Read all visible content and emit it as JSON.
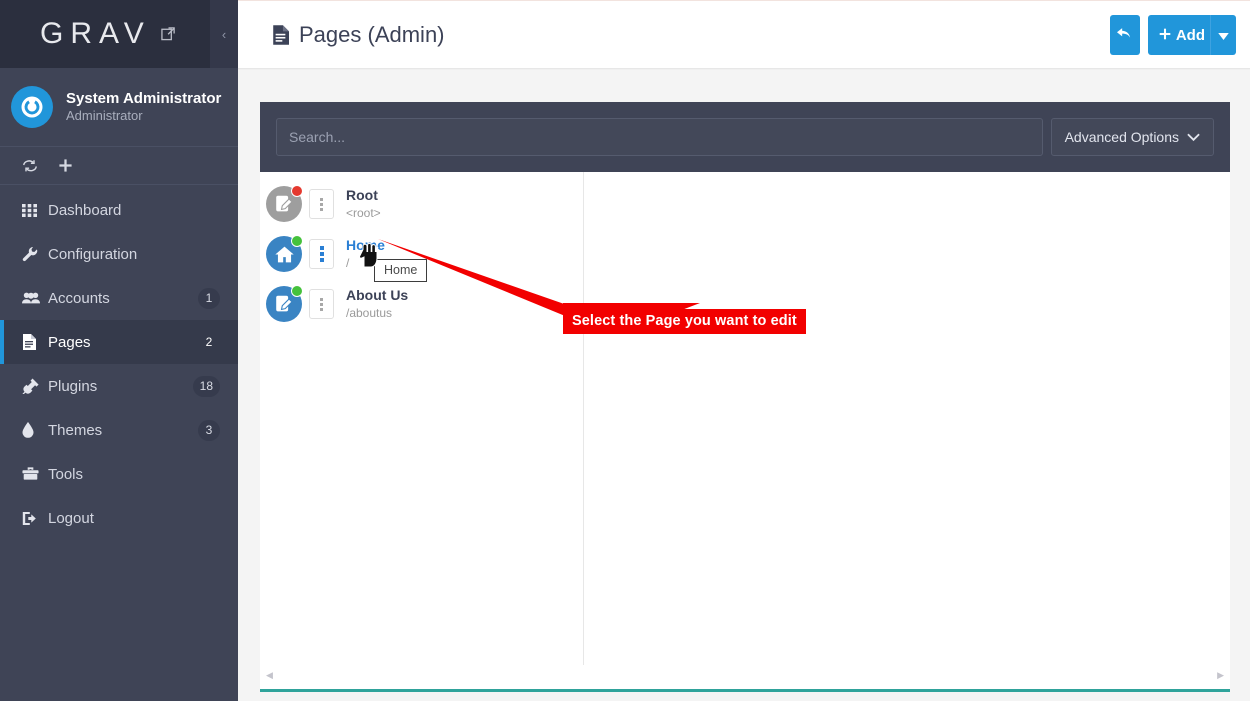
{
  "sidebar": {
    "brand": {
      "logo": "GRAV",
      "external_link_icon": "external-link-icon",
      "collapse_icon": "‹"
    },
    "user": {
      "name": "System Administrator",
      "role": "Administrator",
      "avatar_icon": "grav-power-icon"
    },
    "quick_actions": [
      {
        "name": "sync-icon",
        "glyph": "sync-icon"
      },
      {
        "name": "add-icon",
        "glyph": "+"
      }
    ],
    "items": [
      {
        "label": "Dashboard",
        "icon": "grid-icon",
        "badge": "",
        "active": false
      },
      {
        "label": "Configuration",
        "icon": "wrench-icon",
        "badge": "",
        "active": false
      },
      {
        "label": "Accounts",
        "icon": "users-icon",
        "badge": "1",
        "active": false
      },
      {
        "label": "Pages",
        "icon": "file-icon",
        "badge": "2",
        "active": true
      },
      {
        "label": "Plugins",
        "icon": "plug-icon",
        "badge": "18",
        "active": false
      },
      {
        "label": "Themes",
        "icon": "droplet-icon",
        "badge": "3",
        "active": false
      },
      {
        "label": "Tools",
        "icon": "toolbox-icon",
        "badge": "",
        "active": false
      },
      {
        "label": "Logout",
        "icon": "logout-icon",
        "badge": "",
        "active": false
      }
    ]
  },
  "topbar": {
    "title": "Pages (Admin)",
    "title_icon": "file-icon",
    "back_button": {
      "label": "",
      "icon": "undo-arrow-icon"
    },
    "add_button": {
      "label": "Add",
      "icon": "plus-icon"
    },
    "add_dropdown": {
      "icon": "caret-down-icon"
    }
  },
  "search": {
    "placeholder": "Search...",
    "value": "",
    "advanced_options_label": "Advanced Options",
    "advanced_options_icon": "chevron-down-icon"
  },
  "tree": {
    "rows": [
      {
        "title": "Root",
        "path": "<root>",
        "icon": "page-edit-icon",
        "icon_color": "gray",
        "status": "red",
        "is_link": false,
        "kebab_active": false
      },
      {
        "title": "Home",
        "path": "/",
        "icon": "home-icon",
        "icon_color": "blue",
        "status": "green",
        "is_link": true,
        "kebab_active": true
      },
      {
        "title": "About Us",
        "path": "/aboutus",
        "icon": "page-edit-icon",
        "icon_color": "blue",
        "status": "green",
        "is_link": false,
        "kebab_active": false
      }
    ],
    "scroll_left_icon": "◀",
    "scroll_right_icon": "▶"
  },
  "annotations": {
    "callout_text": "Select the Page you want to edit",
    "callout_color": "#f20000",
    "tooltip_text": "Home",
    "cursor_icon": "pointing-hand-cursor"
  },
  "colors": {
    "sidebar_bg": "#3f4456",
    "sidebar_brand_bg": "#2b2f3e",
    "accent_blue": "#2196da",
    "panel_bottom_teal": "#2fa39b",
    "status_red": "#e5392f",
    "status_green": "#45c13c"
  }
}
